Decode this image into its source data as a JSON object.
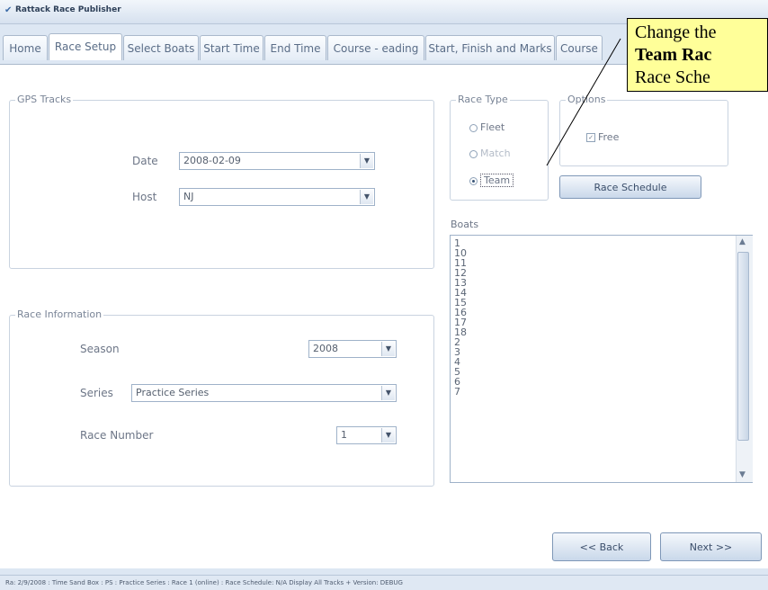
{
  "window": {
    "title": "Rattack Race Publisher"
  },
  "tabs": [
    "Home",
    "Race Setup",
    "Select Boats",
    "Start Time",
    "End Time",
    "Course - eading",
    "Start, Finish and Marks",
    "Course"
  ],
  "gps_tracks": {
    "legend": "GPS Tracks",
    "date_label": "Date",
    "date_value": "2008-02-09",
    "host_label": "Host",
    "host_value": "NJ"
  },
  "race_information": {
    "legend": "Race Information",
    "season_label": "Season",
    "season_value": "2008",
    "series_label": "Series",
    "series_value": "Practice Series",
    "race_number_label": "Race Number",
    "race_number_value": "1"
  },
  "race_type": {
    "legend": "Race Type",
    "options": [
      "Fleet",
      "Match",
      "Team"
    ],
    "selected": "Team"
  },
  "options": {
    "legend": "Options",
    "free_label": "Free"
  },
  "race_schedule_button": "Race Schedule",
  "boats": {
    "label": "Boats",
    "items": [
      "1",
      "10",
      "11",
      "12",
      "13",
      "14",
      "15",
      "16",
      "17",
      "18",
      "2",
      "3",
      "4",
      "5",
      "6",
      "7"
    ]
  },
  "nav": {
    "back": "<< Back",
    "next": "Next >>"
  },
  "status_bar": "Ra:  2/9/2008  :  Time Sand Box  :  PS  :  Practice Series  :  Race 1  (online)  :  Race Schedule: N/A   Display All Tracks  +  Version: DEBUG",
  "callout": {
    "line1": "Change the",
    "line2": "Team Rac",
    "line3": "Race Sche"
  }
}
